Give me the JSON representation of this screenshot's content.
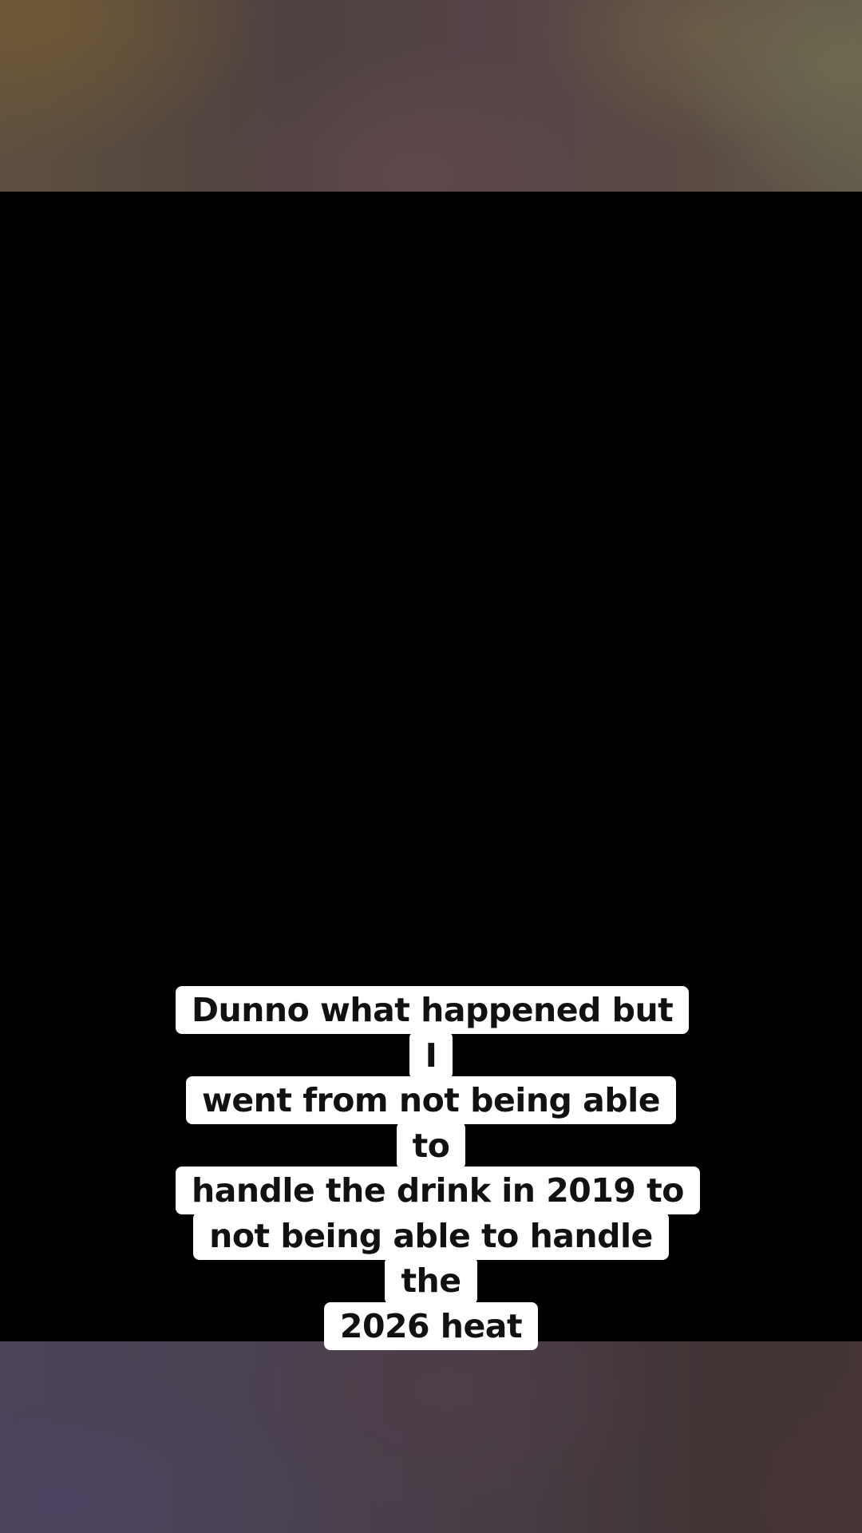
{
  "caption": {
    "line1": "Dunno what happened but I",
    "line2": "went from not being able to",
    "line3": "handle the drink in 2019 to",
    "line4": "not being able to handle the",
    "line5": "2026 heat"
  }
}
